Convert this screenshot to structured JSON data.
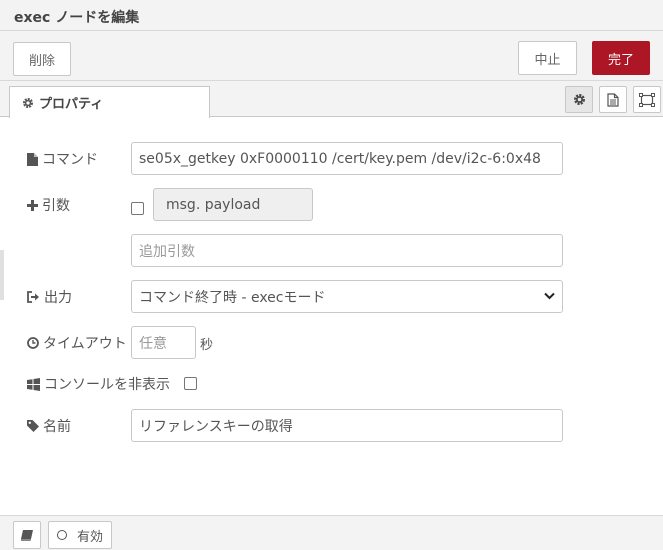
{
  "header": {
    "title": "exec ノードを編集"
  },
  "toolbar": {
    "delete_label": "削除",
    "cancel_label": "中止",
    "done_label": "完了",
    "done_color": "#ad1625"
  },
  "tabs": {
    "properties_label": "プロパティ"
  },
  "icons": {
    "properties": "gear-icon",
    "settings": "gear-icon",
    "description": "file-text-icon",
    "appearance": "frame-icon",
    "command": "file-icon",
    "append": "plus-icon",
    "output": "sign-out-icon",
    "timeout": "clock-icon",
    "windows": "windows-icon",
    "name": "tag-icon",
    "footer_book": "book-icon"
  },
  "form": {
    "command": {
      "label": "コマンド",
      "value": "se05x_getkey 0xF0000110 /cert/key.pem /dev/i2c-6:0x48"
    },
    "append": {
      "label": "引数",
      "payload_label": "msg. payload",
      "extra_placeholder": "追加引数"
    },
    "output": {
      "label": "出力",
      "selected": "コマンド終了時 - execモード"
    },
    "timeout": {
      "label": "タイムアウト",
      "placeholder": "任意",
      "unit": "秒"
    },
    "hide_console": {
      "label": "コンソールを非表示"
    },
    "name": {
      "label": "名前",
      "value": "リファレンスキーの取得"
    }
  },
  "footer": {
    "enabled_label": "有効"
  }
}
